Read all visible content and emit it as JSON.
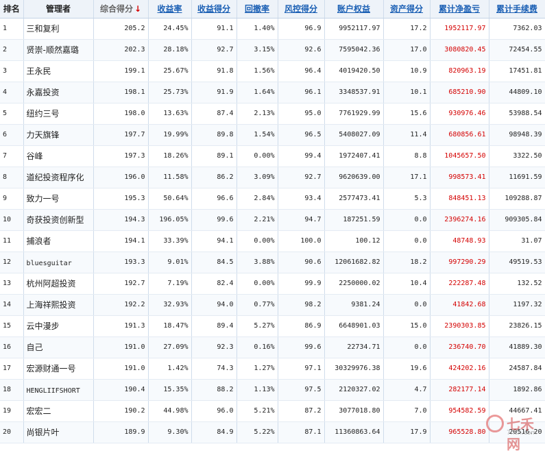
{
  "headers": {
    "rank": "排名",
    "manager": "管理者",
    "composite_score": "综合得分",
    "composite_score_sort_arrow": "↓",
    "return_rate": "收益率",
    "return_score": "收益得分",
    "drawdown": "回撤率",
    "risk_score": "风控得分",
    "account_equity": "账户权益",
    "asset_score": "资产得分",
    "cum_net_pnl": "累计净盈亏",
    "cum_fees": "累计手续费"
  },
  "colors": {
    "header_link": "#1a5fb4",
    "profit": "#d40000",
    "sort_arrow": "#d40000"
  },
  "rows": [
    {
      "rank": "1",
      "manager": "三和复利",
      "score": "205.2",
      "return_rate": "24.45%",
      "return_score": "91.1",
      "drawdown": "1.40%",
      "risk_score": "96.9",
      "equity": "9952117.97",
      "asset_score": "17.2",
      "pnl": "1952117.97",
      "fees": "7362.03"
    },
    {
      "rank": "2",
      "manager": "贤崇-顺然嘉璐",
      "score": "202.3",
      "return_rate": "28.18%",
      "return_score": "92.7",
      "drawdown": "3.15%",
      "risk_score": "92.6",
      "equity": "7595042.36",
      "asset_score": "17.0",
      "pnl": "3080820.45",
      "fees": "72454.55"
    },
    {
      "rank": "3",
      "manager": "王永民",
      "score": "199.1",
      "return_rate": "25.67%",
      "return_score": "91.8",
      "drawdown": "1.56%",
      "risk_score": "96.4",
      "equity": "4019420.50",
      "asset_score": "10.9",
      "pnl": "820963.19",
      "fees": "17451.81"
    },
    {
      "rank": "4",
      "manager": "永嘉投资",
      "score": "198.1",
      "return_rate": "25.73%",
      "return_score": "91.9",
      "drawdown": "1.64%",
      "risk_score": "96.1",
      "equity": "3348537.91",
      "asset_score": "10.1",
      "pnl": "685210.90",
      "fees": "44809.10"
    },
    {
      "rank": "5",
      "manager": "纽约三号",
      "score": "198.0",
      "return_rate": "13.63%",
      "return_score": "87.4",
      "drawdown": "2.13%",
      "risk_score": "95.0",
      "equity": "7761929.99",
      "asset_score": "15.6",
      "pnl": "930976.46",
      "fees": "53988.54"
    },
    {
      "rank": "6",
      "manager": "力天旗锋",
      "score": "197.7",
      "return_rate": "19.99%",
      "return_score": "89.8",
      "drawdown": "1.54%",
      "risk_score": "96.5",
      "equity": "5408027.09",
      "asset_score": "11.4",
      "pnl": "680856.61",
      "fees": "98948.39"
    },
    {
      "rank": "7",
      "manager": "谷峰",
      "score": "197.3",
      "return_rate": "18.26%",
      "return_score": "89.1",
      "drawdown": "0.00%",
      "risk_score": "99.4",
      "equity": "1972407.41",
      "asset_score": "8.8",
      "pnl": "1045657.50",
      "fees": "3322.50"
    },
    {
      "rank": "8",
      "manager": "道纪投资程序化",
      "score": "196.0",
      "return_rate": "11.58%",
      "return_score": "86.2",
      "drawdown": "3.09%",
      "risk_score": "92.7",
      "equity": "9620639.00",
      "asset_score": "17.1",
      "pnl": "998573.41",
      "fees": "11691.59"
    },
    {
      "rank": "9",
      "manager": "致力一号",
      "score": "195.3",
      "return_rate": "50.64%",
      "return_score": "96.6",
      "drawdown": "2.84%",
      "risk_score": "93.4",
      "equity": "2577473.41",
      "asset_score": "5.3",
      "pnl": "848451.13",
      "fees": "109288.87"
    },
    {
      "rank": "10",
      "manager": "奇获投资创新型",
      "score": "194.3",
      "return_rate": "196.05%",
      "return_score": "99.6",
      "drawdown": "2.21%",
      "risk_score": "94.7",
      "equity": "187251.59",
      "asset_score": "0.0",
      "pnl": "2396274.16",
      "fees": "909305.84"
    },
    {
      "rank": "11",
      "manager": "捕浪者",
      "score": "194.1",
      "return_rate": "33.39%",
      "return_score": "94.1",
      "drawdown": "0.00%",
      "risk_score": "100.0",
      "equity": "100.12",
      "asset_score": "0.0",
      "pnl": "48748.93",
      "fees": "31.07"
    },
    {
      "rank": "12",
      "manager": "bluesguitar",
      "score": "193.3",
      "return_rate": "9.01%",
      "return_score": "84.5",
      "drawdown": "3.88%",
      "risk_score": "90.6",
      "equity": "12061682.82",
      "asset_score": "18.2",
      "pnl": "997290.29",
      "fees": "49519.53"
    },
    {
      "rank": "13",
      "manager": "杭州阿超投资",
      "score": "192.7",
      "return_rate": "7.19%",
      "return_score": "82.4",
      "drawdown": "0.00%",
      "risk_score": "99.9",
      "equity": "2250000.02",
      "asset_score": "10.4",
      "pnl": "222287.48",
      "fees": "132.52"
    },
    {
      "rank": "14",
      "manager": "上海祥熙投资",
      "score": "192.2",
      "return_rate": "32.93%",
      "return_score": "94.0",
      "drawdown": "0.77%",
      "risk_score": "98.2",
      "equity": "9381.24",
      "asset_score": "0.0",
      "pnl": "41842.68",
      "fees": "1197.32"
    },
    {
      "rank": "15",
      "manager": "云中漫步",
      "score": "191.3",
      "return_rate": "18.47%",
      "return_score": "89.4",
      "drawdown": "5.27%",
      "risk_score": "86.9",
      "equity": "6648901.03",
      "asset_score": "15.0",
      "pnl": "2390303.85",
      "fees": "23826.15"
    },
    {
      "rank": "16",
      "manager": "自己",
      "score": "191.0",
      "return_rate": "27.09%",
      "return_score": "92.3",
      "drawdown": "0.16%",
      "risk_score": "99.6",
      "equity": "22734.71",
      "asset_score": "0.0",
      "pnl": "236740.70",
      "fees": "41889.30"
    },
    {
      "rank": "17",
      "manager": "宏源财通一号",
      "score": "191.0",
      "return_rate": "1.42%",
      "return_score": "74.3",
      "drawdown": "1.27%",
      "risk_score": "97.1",
      "equity": "30329976.38",
      "asset_score": "19.6",
      "pnl": "424202.16",
      "fees": "24587.84"
    },
    {
      "rank": "18",
      "manager": "HENGLIIFSHORT",
      "score": "190.4",
      "return_rate": "15.35%",
      "return_score": "88.2",
      "drawdown": "1.13%",
      "risk_score": "97.5",
      "equity": "2120327.02",
      "asset_score": "4.7",
      "pnl": "282177.14",
      "fees": "1892.86"
    },
    {
      "rank": "19",
      "manager": "宏宏二",
      "score": "190.2",
      "return_rate": "44.98%",
      "return_score": "96.0",
      "drawdown": "5.21%",
      "risk_score": "87.2",
      "equity": "3077018.80",
      "asset_score": "7.0",
      "pnl": "954582.59",
      "fees": "44667.41"
    },
    {
      "rank": "20",
      "manager": "尚银片叶",
      "score": "189.9",
      "return_rate": "9.30%",
      "return_score": "84.9",
      "drawdown": "5.22%",
      "risk_score": "87.1",
      "equity": "11360863.64",
      "asset_score": "17.9",
      "pnl": "965528.80",
      "fees": "20516.20"
    }
  ],
  "watermark": {
    "text": "七禾网",
    "url": "7hcn.com"
  }
}
